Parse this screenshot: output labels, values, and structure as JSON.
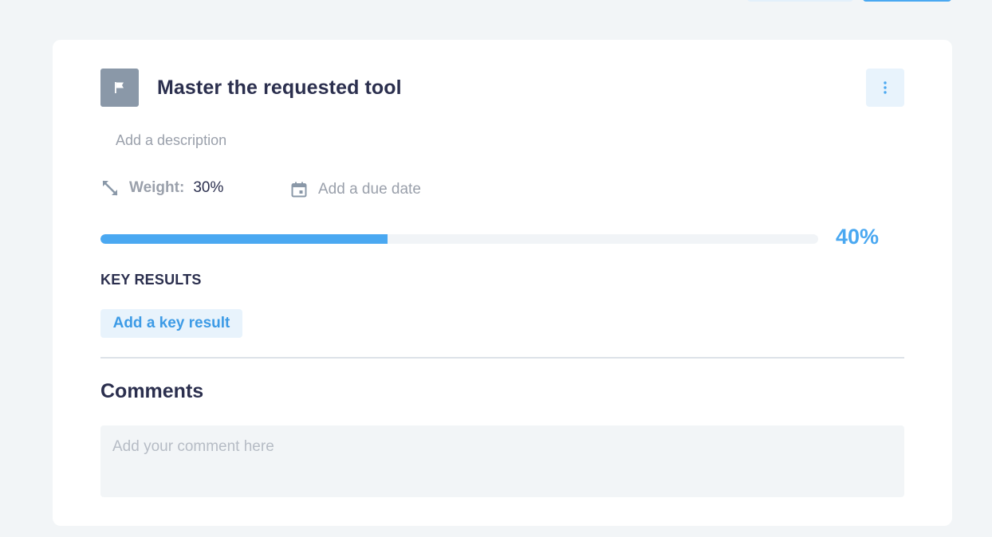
{
  "objective": {
    "title": "Master the requested tool",
    "description_placeholder": "Add a description",
    "weight": {
      "label": "Weight:",
      "value": "30%"
    },
    "due_date_placeholder": "Add a due date",
    "progress": {
      "value": 40,
      "label": "40%"
    }
  },
  "key_results": {
    "heading": "KEY RESULTS",
    "add_button_label": "Add a key result"
  },
  "comments": {
    "heading": "Comments",
    "placeholder": "Add your comment here"
  },
  "icons": {
    "objective": "flag-icon",
    "menu": "more-vertical-icon",
    "weight": "expand-diagonal-icon",
    "due_date": "calendar-icon"
  },
  "colors": {
    "accent": "#4aa8f1",
    "accent_light": "#e8f3fc",
    "text_primary": "#2b2f4e",
    "text_muted": "#9aa0ab",
    "flag_bg": "#8a98a8",
    "background": "#f2f5f7"
  }
}
